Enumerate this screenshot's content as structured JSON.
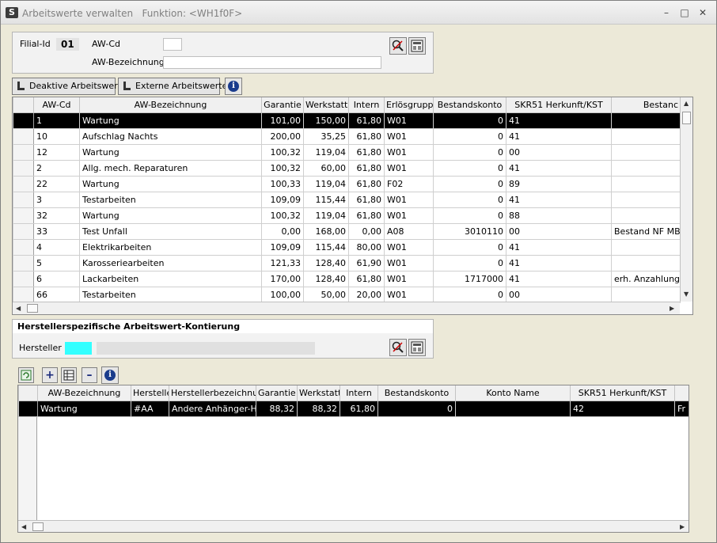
{
  "window": {
    "title": "Arbeitswerte verwalten",
    "funktion": "Funktion: <WH1f0F>",
    "app_icon": "S"
  },
  "filter": {
    "filial_label": "Filial-Id",
    "filial_value": "01",
    "awcd_label": "AW-Cd",
    "awcd_value": "",
    "bez_label": "AW-Bezeichnung",
    "bez_value": ""
  },
  "toolbar": {
    "deaktive": "Deaktive Arbeitswerte",
    "externe": "Externe Arbeitswerte"
  },
  "grid1": {
    "headers": [
      "AW-Cd",
      "AW-Bezeichnung",
      "Garantie",
      "Werkstatt",
      "Intern",
      "Erlösgruppe",
      "Bestandskonto",
      "SKR51 Herkunft/KST",
      "Bestanc"
    ],
    "rows": [
      [
        "1",
        "Wartung",
        "101,00",
        "150,00",
        "61,80",
        "W01",
        "0",
        "41",
        ""
      ],
      [
        "10",
        "Aufschlag Nachts",
        "200,00",
        "35,25",
        "61,80",
        "W01",
        "0",
        "41",
        ""
      ],
      [
        "12",
        "Wartung",
        "100,32",
        "119,04",
        "61,80",
        "W01",
        "0",
        "00",
        ""
      ],
      [
        "2",
        "Allg. mech. Reparaturen",
        "100,32",
        "60,00",
        "61,80",
        "W01",
        "0",
        "41",
        ""
      ],
      [
        "22",
        "Wartung",
        "100,33",
        "119,04",
        "61,80",
        "F02",
        "0",
        "89",
        ""
      ],
      [
        "3",
        "Testarbeiten",
        "109,09",
        "115,44",
        "61,80",
        "W01",
        "0",
        "41",
        ""
      ],
      [
        "32",
        "Wartung",
        "100,32",
        "119,04",
        "61,80",
        "W01",
        "0",
        "88",
        ""
      ],
      [
        "33",
        "Test Unfall",
        "0,00",
        "168,00",
        "0,00",
        "A08",
        "3010110",
        "00",
        "Bestand NF MB"
      ],
      [
        "4",
        "Elektrikarbeiten",
        "109,09",
        "115,44",
        "80,00",
        "W01",
        "0",
        "41",
        ""
      ],
      [
        "5",
        "Karosseriearbeiten",
        "121,33",
        "128,40",
        "61,90",
        "W01",
        "0",
        "41",
        ""
      ],
      [
        "6",
        "Lackarbeiten",
        "170,00",
        "128,40",
        "61,80",
        "W01",
        "1717000",
        "41",
        "erh. Anzahlunge"
      ],
      [
        "66",
        "Testarbeiten",
        "100,00",
        "50,00",
        "20,00",
        "W01",
        "0",
        "00",
        ""
      ]
    ]
  },
  "hersteller_section": {
    "title": "Herstellerspezifische Arbeitswert-Kontierung",
    "hersteller_label": "Hersteller",
    "hersteller_value": "",
    "hersteller_name": ""
  },
  "grid2": {
    "headers": [
      "AW-Bezeichnung",
      "Hersteller",
      "Herstellerbezeichnung",
      "Garantie",
      "Werkstatt",
      "Intern",
      "Bestandskonto",
      "Konto Name",
      "SKR51 Herkunft/KST",
      ""
    ],
    "rows": [
      [
        "Wartung",
        "#AA",
        "Andere Anhänger-Her",
        "88,32",
        "88,32",
        "61,80",
        "0",
        "",
        "42",
        "Fr"
      ]
    ]
  },
  "colors": {
    "accent_cyan": "#33ffff",
    "selection": "#000000"
  }
}
